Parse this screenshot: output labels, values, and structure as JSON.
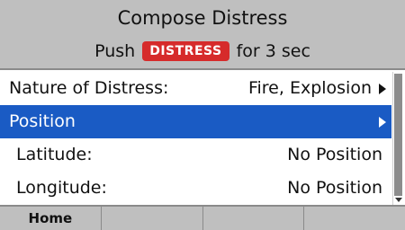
{
  "header": {
    "title": "Compose Distress",
    "push_prefix": "Push",
    "distress_button": "DISTRESS",
    "push_suffix": "for 3 sec"
  },
  "menu": {
    "items": [
      {
        "label": "Nature of Distress:",
        "value": "Fire, Explosion",
        "has_submenu": true,
        "selected": false
      },
      {
        "label": "Position",
        "value": "",
        "has_submenu": true,
        "selected": true
      },
      {
        "label": "Latitude:",
        "value": "No Position",
        "has_submenu": false,
        "selected": false
      },
      {
        "label": "Longitude:",
        "value": "No Position",
        "has_submenu": false,
        "selected": false
      }
    ]
  },
  "softkeys": [
    "Home",
    "",
    "",
    ""
  ],
  "colors": {
    "selection": "#1a5bc4",
    "distress_badge": "#d62b2b",
    "bar_gray": "#bfbfbf"
  }
}
